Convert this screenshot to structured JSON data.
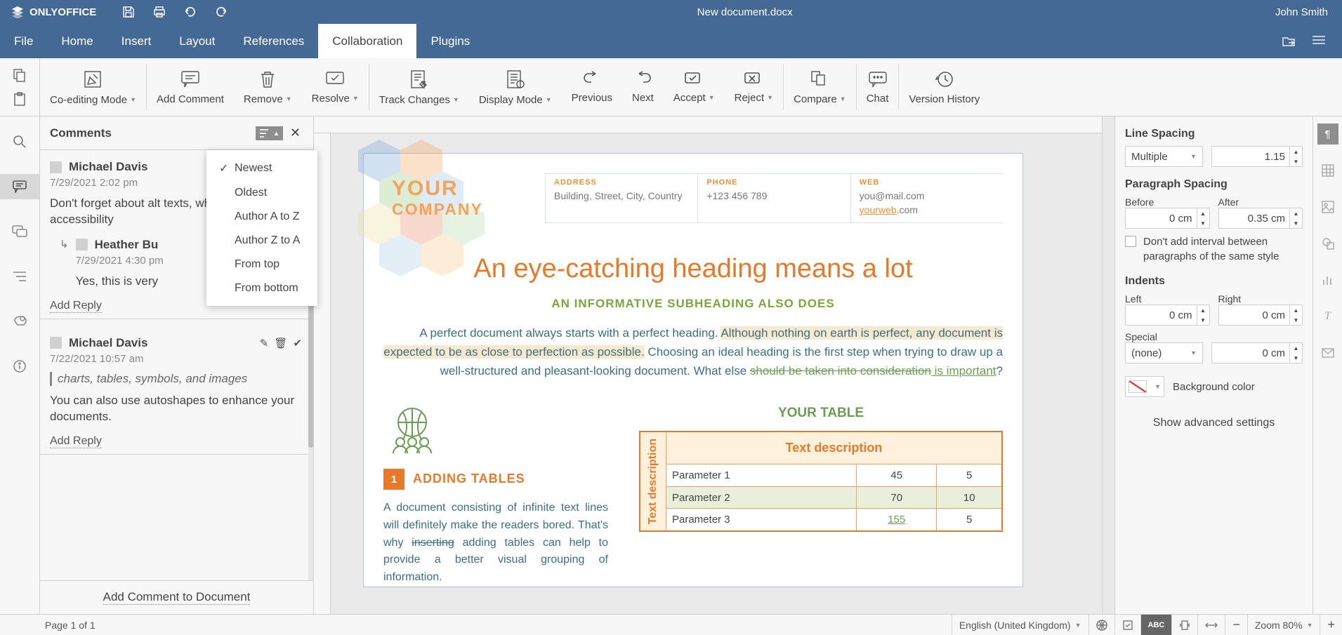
{
  "brand": "ONLYOFFICE",
  "doc_title": "New document.docx",
  "user_name": "John Smith",
  "tabs": [
    "File",
    "Home",
    "Insert",
    "Layout",
    "References",
    "Collaboration",
    "Plugins"
  ],
  "active_tab": 5,
  "ribbon": {
    "coedit": "Co-editing Mode",
    "add_comment": "Add Comment",
    "remove": "Remove",
    "resolve": "Resolve",
    "track": "Track Changes",
    "display": "Display Mode",
    "previous": "Previous",
    "next": "Next",
    "accept": "Accept",
    "reject": "Reject",
    "compare": "Compare",
    "chat": "Chat",
    "history": "Version History"
  },
  "comments_title": "Comments",
  "sort_options": [
    "Newest",
    "Oldest",
    "Author A to Z",
    "Author Z to A",
    "From top",
    "From bottom"
  ],
  "sort_selected": 0,
  "comments": [
    {
      "author": "Michael Davis",
      "date": "7/29/2021 2:02 pm",
      "text": "Don't forget about alt texts, which improve accessibility",
      "replies": [
        {
          "author": "Heather Bu",
          "date": "7/29/2021 4:30 pm",
          "text": "Yes, this is very"
        }
      ]
    },
    {
      "author": "Michael Davis",
      "date": "7/22/2021 10:57 am",
      "quote": "charts, tables, symbols, and images",
      "text": "You can also use autoshapes to enhance your documents."
    }
  ],
  "add_reply": "Add Reply",
  "add_comment_doc": "Add Comment to Document",
  "doc": {
    "company": "YOUR",
    "company2": "COMPANY",
    "address_label": "ADDRESS",
    "address_body": "Building, Street, City, Country",
    "phone_label": "PHONE",
    "phone_body": "+123 456 789",
    "web_label": "WEB",
    "web_body1": "you@mail.com",
    "web_link": "yourweb",
    "web_body2": ".com",
    "h1": "An eye-catching heading means a lot",
    "h2": "AN INFORMATIVE SUBHEADING ALSO DOES",
    "p1a": "A perfect document always starts with a perfect heading. ",
    "p1b": "Although nothing on earth is perfect, any document is expected to be as close to perfection as possible.",
    "p1c": " Choosing an ideal heading is the first step when trying to draw up a well-structured and pleasant-looking document. What else ",
    "p1d": "should be taken into consideration",
    "p1e": " is important",
    "p1q": "?",
    "sec_num": "1",
    "sec_title": "ADDING TABLES",
    "sec_text_a": "A document consisting of infinite text lines will definitely make the readers bored. That's why ",
    "sec_text_strike": "inserting",
    "sec_text_b": " adding tables can help to provide a better visual grouping of information.",
    "your_table": "YOUR TABLE",
    "table_header": "Text description",
    "rot": "Text description",
    "rows": [
      [
        "Parameter 1",
        "45",
        "5"
      ],
      [
        "Parameter 2",
        "70",
        "10"
      ],
      [
        "Parameter 3",
        "155",
        "5"
      ]
    ]
  },
  "right": {
    "line_spacing": "Line Spacing",
    "ls_mode": "Multiple",
    "ls_val": "1.15",
    "para_spacing": "Paragraph Spacing",
    "before": "Before",
    "after": "After",
    "before_val": "0 cm",
    "after_val": "0.35 cm",
    "no_interval": "Don't add interval between paragraphs of the same style",
    "indents": "Indents",
    "left": "Left",
    "right_l": "Right",
    "left_val": "0 cm",
    "right_val": "0 cm",
    "special": "Special",
    "special_mode": "(none)",
    "special_val": "0 cm",
    "bg_color": "Background color",
    "advanced": "Show advanced settings"
  },
  "status": {
    "page": "Page 1 of 1",
    "lang": "English (United Kingdom)",
    "zoom": "Zoom 80%"
  }
}
